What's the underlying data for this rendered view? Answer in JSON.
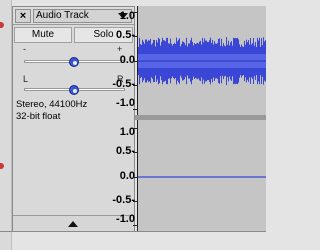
{
  "track": {
    "close_label": "×",
    "name": "Audio Track",
    "mute_label": "Mute",
    "solo_label": "Solo",
    "gain": {
      "min_label": "-",
      "max_label": "+",
      "value": 0.5
    },
    "pan": {
      "left_label": "L",
      "right_label": "R",
      "value": 0.5
    },
    "format": "Stereo, 44100Hz",
    "bit_depth": "32-bit float",
    "collapse_icon": "triangle-up-icon"
  },
  "ruler_upper": [
    "1.0",
    "0.5-",
    "0.0",
    "-0.5-",
    "-1.0"
  ],
  "ruler_lower": [
    "1.0",
    "0.5-",
    "0.0",
    "-0.5-",
    "-1.0"
  ],
  "colors": {
    "waveform": "#3a46d6",
    "waveform_rms": "#5c6ae8",
    "knob": "#3a55d6"
  }
}
